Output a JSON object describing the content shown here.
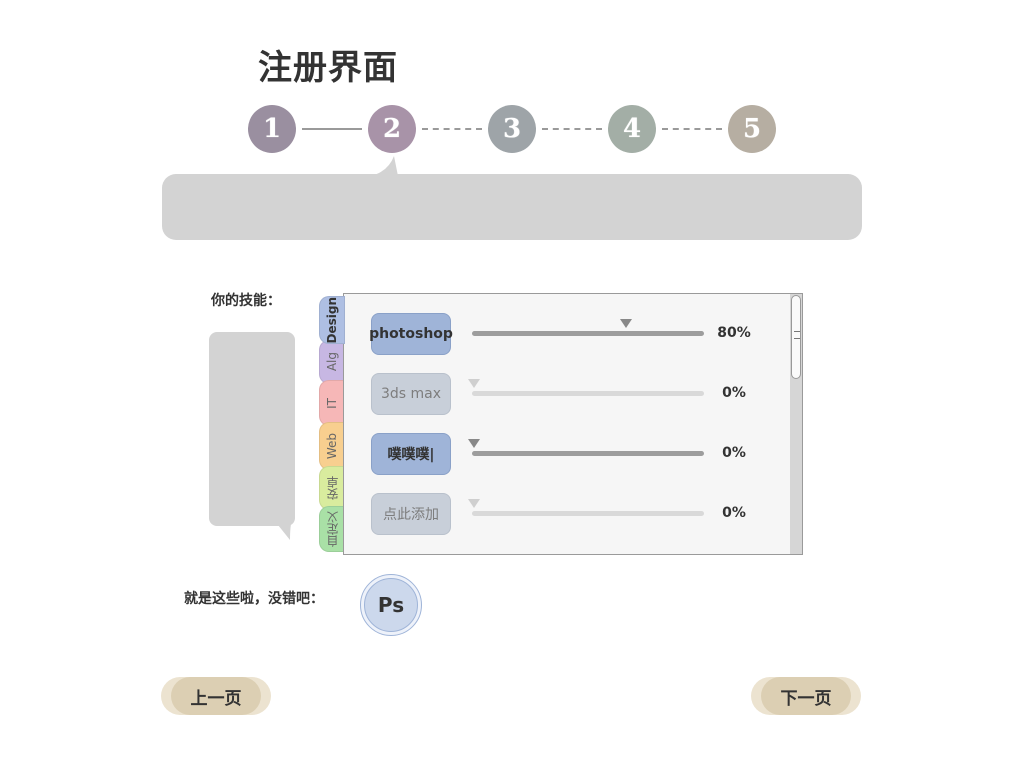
{
  "title": "注册界面",
  "steps": [
    {
      "label": "1",
      "color": "#9a8fa0",
      "state": "done"
    },
    {
      "label": "2",
      "color": "#a893a8",
      "state": "current"
    },
    {
      "label": "3",
      "color": "#9ea4a8",
      "state": "todo"
    },
    {
      "label": "4",
      "color": "#a3aea6",
      "state": "todo"
    },
    {
      "label": "5",
      "color": "#b6aea2",
      "state": "todo"
    }
  ],
  "skills_section": {
    "label": "你的技能：",
    "tabs": [
      {
        "label": "Design",
        "color": "#aebfe3",
        "active": true
      },
      {
        "label": "Alg",
        "color": "#c7b7e3",
        "active": false
      },
      {
        "label": "IT",
        "color": "#f6b7b7",
        "active": false
      },
      {
        "label": "Web",
        "color": "#f8cf8f",
        "active": false
      },
      {
        "label": "安卓",
        "color": "#d9ec9e",
        "active": false
      },
      {
        "label": "自定义",
        "color": "#a9e0a6",
        "active": false
      }
    ],
    "skills": [
      {
        "name": "photoshop",
        "percent_label": "80%",
        "level": 0.8,
        "active": true
      },
      {
        "name": "3ds max",
        "percent_label": "0%",
        "level": 0,
        "active": false
      },
      {
        "name": "噗噗噗|",
        "percent_label": "0%",
        "level": 0,
        "active": true
      },
      {
        "name": "点此添加",
        "percent_label": "0%",
        "level": 0,
        "active": false
      }
    ]
  },
  "summary": {
    "label": "就是这些啦，没错吧：",
    "badges": [
      {
        "label": "Ps"
      }
    ]
  },
  "nav": {
    "prev_label": "上一页",
    "next_label": "下一页"
  },
  "colors": {
    "accent": "#9fb4d8",
    "bubble": "#d3d3d3",
    "nav_button": "#dccfb3"
  }
}
